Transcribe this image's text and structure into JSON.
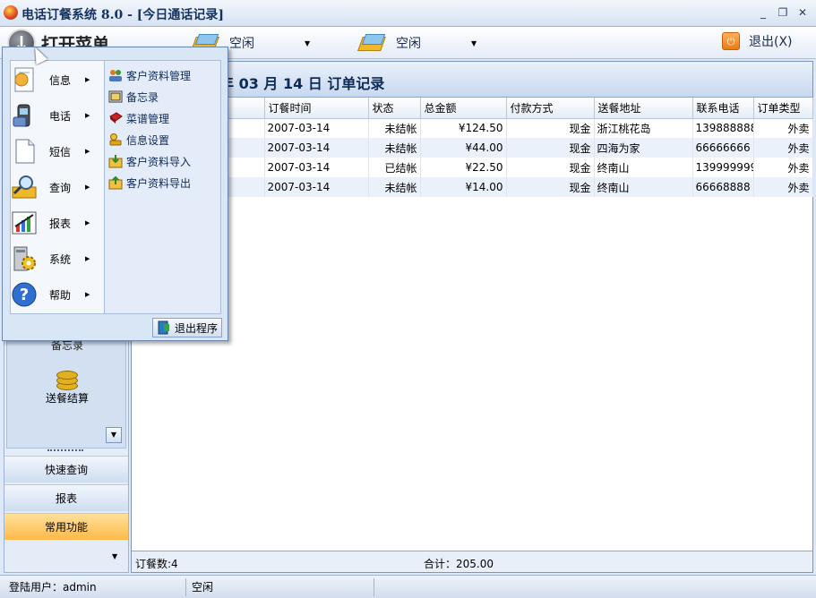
{
  "window": {
    "title": "电话订餐系统 8.0 - [今日通话记录]",
    "minimize": "▭",
    "restore": "❐",
    "close": "✕"
  },
  "toolbar": {
    "open_menu_label": "打开菜单",
    "line1_status": "空闲",
    "line2_status": "空闲",
    "exit_label": "退出(X)"
  },
  "popup": {
    "categories": [
      {
        "label": "信息",
        "icon": "info-doc-icon"
      },
      {
        "label": "电话",
        "icon": "phone-icon"
      },
      {
        "label": "短信",
        "icon": "sms-doc-icon"
      },
      {
        "label": "查询",
        "icon": "search-icon"
      },
      {
        "label": "报表",
        "icon": "report-chart-icon"
      },
      {
        "label": "系统",
        "icon": "system-gear-icon"
      },
      {
        "label": "帮助",
        "icon": "help-icon"
      }
    ],
    "submenu": [
      {
        "label": "客户资料管理",
        "icon": "users-icon"
      },
      {
        "label": "备忘录",
        "icon": "memo-icon"
      },
      {
        "label": "菜谱管理",
        "icon": "book-icon"
      },
      {
        "label": "信息设置",
        "icon": "settings-icon"
      },
      {
        "label": "客户资料导入",
        "icon": "import-icon"
      },
      {
        "label": "客户资料导出",
        "icon": "export-icon"
      }
    ],
    "exit_program": "退出程序"
  },
  "leftpanel": {
    "memo_label": "备忘录",
    "delivery_label": "送餐结算",
    "nav": [
      "快速查询",
      "报表",
      "常用功能"
    ]
  },
  "main": {
    "title": "年 03 月 14 日 订单记录",
    "columns": [
      "称",
      "订餐时间",
      "状态",
      "总金额",
      "付款方式",
      "送餐地址",
      "联系电话",
      "订单类型"
    ],
    "rows": [
      {
        "name": "",
        "time": "2007-03-14",
        "status": "未结帐",
        "amount": "¥124.50",
        "pay": "现金",
        "addr": "浙江桃花岛",
        "phone": "139888888",
        "type": "外卖"
      },
      {
        "name": "",
        "time": "2007-03-14",
        "status": "未结帐",
        "amount": "¥44.00",
        "pay": "现金",
        "addr": "四海为家",
        "phone": "66666666",
        "type": "外卖"
      },
      {
        "name": "",
        "time": "2007-03-14",
        "status": "已结帐",
        "amount": "¥22.50",
        "pay": "现金",
        "addr": "终南山",
        "phone": "139999999",
        "type": "外卖"
      },
      {
        "name": "",
        "time": "2007-03-14",
        "status": "未结帐",
        "amount": "¥14.00",
        "pay": "现金",
        "addr": "终南山",
        "phone": "66668888",
        "type": "外卖"
      }
    ],
    "count_text": "订餐数:4",
    "sum_text": "合计：205.00"
  },
  "statusbar": {
    "user": "登陆用户：admin",
    "line_status": "空闲"
  }
}
